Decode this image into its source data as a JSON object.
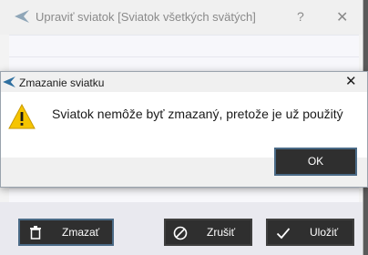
{
  "background_window": {
    "title": "Upraviť sviatok [Sviatok všetkých svätých]",
    "help_glyph": "?",
    "close_glyph": "✕",
    "buttons": {
      "delete_label": "Zmazať",
      "cancel_label": "Zrušiť",
      "save_label": "Uložiť"
    }
  },
  "dialog": {
    "title": "Zmazanie sviatku",
    "close_glyph": "✕",
    "message": "Sviatok nemôže byť zmazaný, pretože je už použitý",
    "ok_label": "OK",
    "icon": "warning-icon"
  },
  "colors": {
    "dark_button": "#2f2f2f",
    "focus_border": "#4a6a86",
    "warning_yellow": "#f5c400"
  }
}
